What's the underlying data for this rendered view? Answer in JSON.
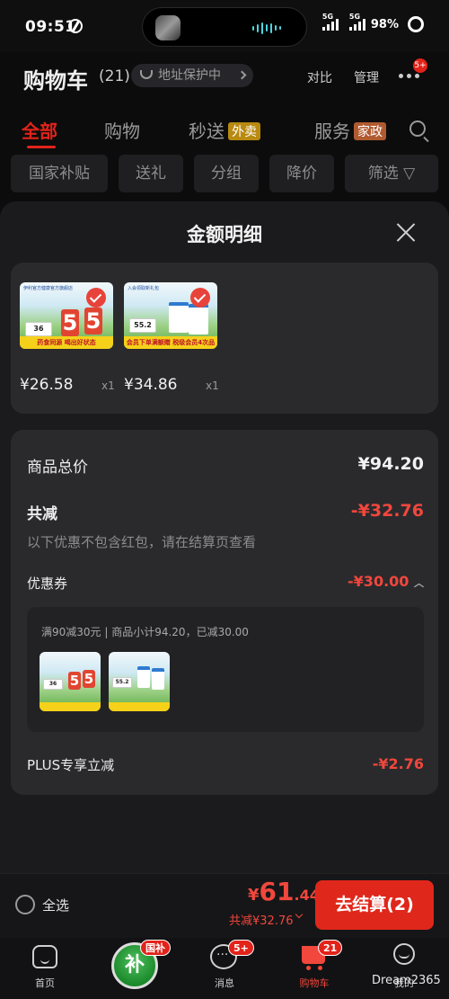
{
  "status_bar": {
    "time": "09:51",
    "signal1": "5G",
    "signal2": "5G",
    "battery": "98%"
  },
  "header": {
    "title": "购物车",
    "count": "(21)",
    "address_tag": "地址保护中",
    "compare": "对比",
    "manage": "管理",
    "more_badge": "5+"
  },
  "tabs": {
    "all": "全部",
    "shopping": "购物",
    "flash": "秒送",
    "flash_tag": "外卖",
    "service": "服务",
    "service_tag": "家政"
  },
  "filters": [
    "国家补贴",
    "送礼",
    "分组",
    "降价",
    "筛选"
  ],
  "sheet": {
    "title": "金额明细",
    "products": [
      {
        "price": "¥26.58",
        "qty": "x1",
        "img_header": "伊利官方健康官方旗舰店",
        "img_badge": "36",
        "img_band": "药食同源 喝出好状态"
      },
      {
        "price": "¥34.86",
        "qty": "x1",
        "img_header": "入会领取新礼包",
        "img_badge": "55.2",
        "img_band": "会员下单满额赠 税级会员4次品券"
      }
    ],
    "total_label": "商品总价",
    "total_value": "¥94.20",
    "reduce_label": "共减",
    "reduce_value": "-¥32.76",
    "note": "以下优惠不包含红包，请在结算页查看",
    "coupon_label": "优惠券",
    "coupon_value": "-¥30.00",
    "coupon_detail": "满90减30元 | 商品小计94.20，已减30.00",
    "plus_label": "PLUS专享立减",
    "plus_value": "-¥2.76"
  },
  "actionbar": {
    "select_all": "全选",
    "total_yen": "¥",
    "total_int": "61",
    "total_dec": ".44",
    "saved": "共减¥32.76",
    "checkout": "去结算(2)"
  },
  "nav": {
    "home": "首页",
    "subsidy_char": "补",
    "subsidy_badge": "国补",
    "messages": "消息",
    "messages_badge": "5+",
    "cart": "购物车",
    "cart_badge": "21",
    "me": "我的"
  },
  "watermark": "Dream2365",
  "colors": {
    "accent": "#e2231a",
    "price_red": "#f1473c",
    "bg": "#0c0c0c",
    "card": "#2a2a2d"
  }
}
